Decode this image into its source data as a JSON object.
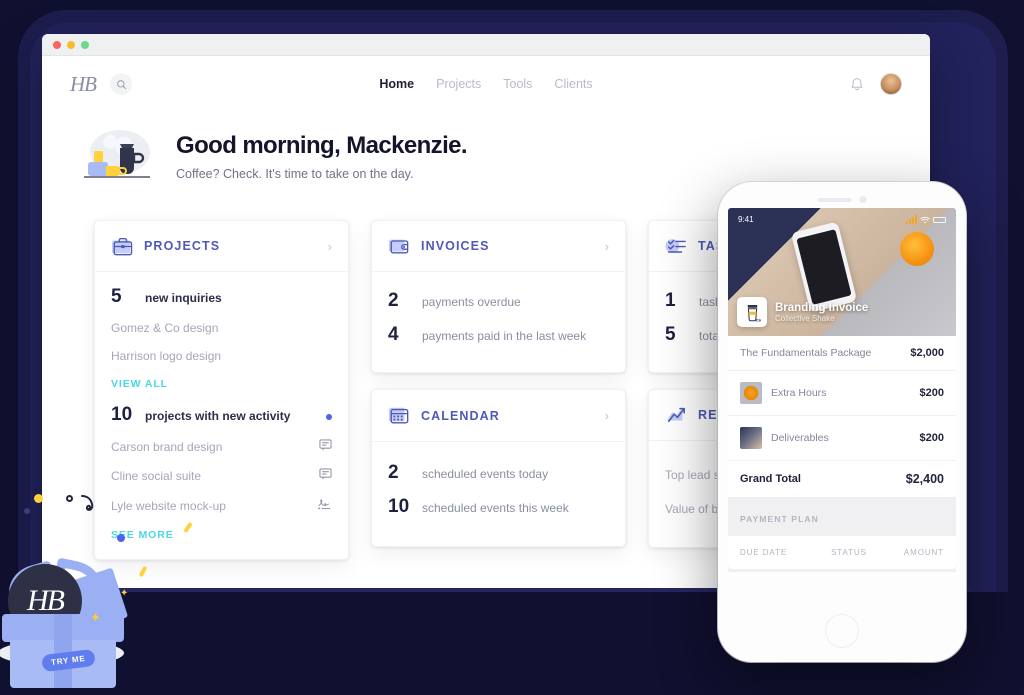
{
  "window": {
    "traffic_lights": [
      "close",
      "minimize",
      "maximize"
    ]
  },
  "nav": {
    "logo_text": "HB",
    "search_icon": "search-icon",
    "links": [
      {
        "label": "Home",
        "active": true
      },
      {
        "label": "Projects",
        "active": false
      },
      {
        "label": "Tools",
        "active": false
      },
      {
        "label": "Clients",
        "active": false
      }
    ],
    "bell_icon": "bell-icon",
    "avatar": "user-avatar"
  },
  "greeting": {
    "title": "Good morning, Mackenzie.",
    "subtitle": "Coffee? Check. It's time to take on the day."
  },
  "cards": {
    "projects": {
      "title": "PROJECTS",
      "icon": "briefcase-icon",
      "stats": [
        {
          "num": "5",
          "label": "new inquiries",
          "dot": false
        },
        {
          "num": "10",
          "label": "projects with new activity",
          "dot": true
        }
      ],
      "inquiries": [
        {
          "name": "Gomez & Co design",
          "icon": ""
        },
        {
          "name": "Harrison logo design",
          "icon": ""
        }
      ],
      "view_all": "VIEW ALL",
      "activity": [
        {
          "name": "Carson brand design",
          "icon": "chat-icon"
        },
        {
          "name": "Cline social suite",
          "icon": "chat-icon"
        },
        {
          "name": "Lyle website mock-up",
          "icon": "signature-icon"
        }
      ],
      "see_more": "SEE MORE"
    },
    "invoices": {
      "title": "INVOICES",
      "icon": "wallet-icon",
      "stats": [
        {
          "num": "2",
          "label": "payments overdue"
        },
        {
          "num": "4",
          "label": "payments paid in the last week"
        }
      ]
    },
    "calendar": {
      "title": "CALENDAR",
      "icon": "calendar-icon",
      "stats": [
        {
          "num": "2",
          "label": "scheduled events today"
        },
        {
          "num": "10",
          "label": "scheduled events this week"
        }
      ]
    },
    "tasks": {
      "title": "TASKS",
      "icon": "checklist-icon",
      "stats": [
        {
          "num": "1",
          "label": "task due"
        },
        {
          "num": "5",
          "label": "total tas"
        }
      ]
    },
    "reports": {
      "title": "REPOR",
      "icon": "chart-up-icon",
      "lines": [
        "Top lead sour",
        "Value of book"
      ]
    }
  },
  "phone": {
    "status_time": "9:41",
    "signal_icon": "signal-bars-icon",
    "wifi_icon": "wifi-icon",
    "battery_icon": "battery-icon",
    "hero_title": "Branding Invoice",
    "hero_subtitle": "Collective Shake",
    "hero_badge_icon": "coffee-cup-icon",
    "line_items": [
      {
        "name": "The Fundamentals Package",
        "amount": "$2,000",
        "thumb": ""
      },
      {
        "name": "Extra Hours",
        "amount": "$200",
        "thumb": "orange-thumb"
      },
      {
        "name": "Deliverables",
        "amount": "$200",
        "thumb": "desk-thumb"
      }
    ],
    "total": {
      "name": "Grand Total",
      "amount": "$2,400"
    },
    "payment_plan_title": "PAYMENT PLAN",
    "payment_plan_columns": [
      "DUE DATE",
      "STATUS",
      "AMOUNT"
    ]
  },
  "gift": {
    "logo_text": "HB",
    "badge_label": "TRY ME"
  },
  "colors": {
    "background": "#101030",
    "device_frame": "#22225c",
    "card_title": "#4f59b8",
    "accent_link": "#4ad7e8",
    "accent_dot": "#4a64f0",
    "heading": "#14142b",
    "muted_text": "#8a8fa0",
    "confetti_yellow": "#ffd13b"
  }
}
